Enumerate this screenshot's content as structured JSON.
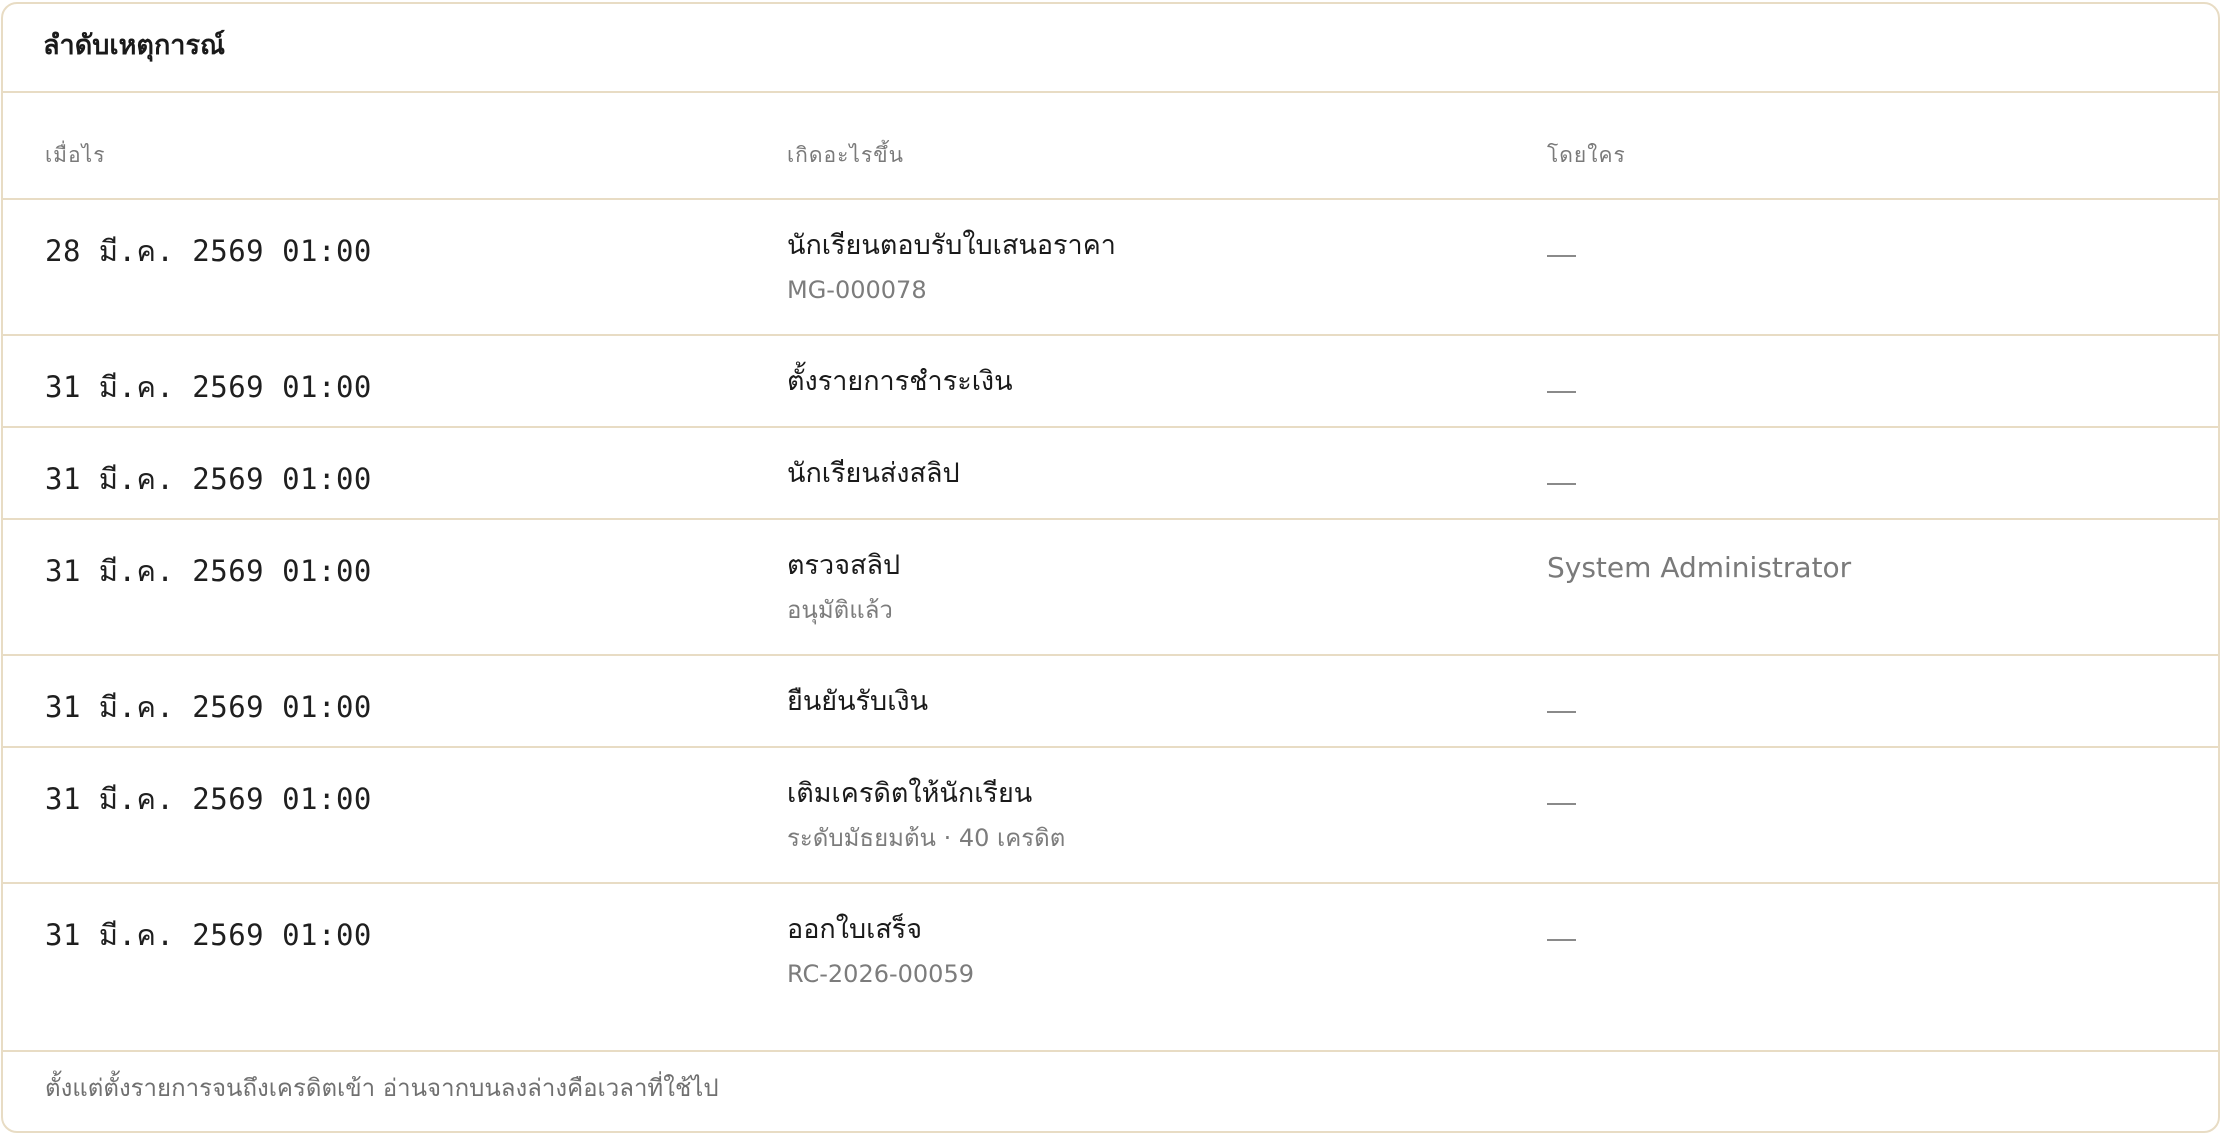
{
  "panel": {
    "title": "ลำดับเหตุการณ์",
    "footer_note": "ตั้งแต่ตั้งรายการจนถึงเครดิตเข้า อ่านจากบนลงล่างคือเวลาที่ใช้ไป"
  },
  "table": {
    "headers": {
      "when": "เมื่อไร",
      "what": "เกิดอะไรขึ้น",
      "who": "โดยใคร"
    },
    "rows": [
      {
        "when": "28 มี.ค. 2569 01:00",
        "what": "นักเรียนตอบรับใบเสนอราคา",
        "detail": "MG-000078",
        "who": "—"
      },
      {
        "when": "31 มี.ค. 2569 01:00",
        "what": "ตั้งรายการชำระเงิน",
        "detail": "",
        "who": "—"
      },
      {
        "when": "31 มี.ค. 2569 01:00",
        "what": "นักเรียนส่งสลิป",
        "detail": "",
        "who": "—"
      },
      {
        "when": "31 มี.ค. 2569 01:00",
        "what": "ตรวจสลิป",
        "detail": "อนุมัติแล้ว",
        "who": "System Administrator"
      },
      {
        "when": "31 มี.ค. 2569 01:00",
        "what": "ยืนยันรับเงิน",
        "detail": "",
        "who": "—"
      },
      {
        "when": "31 มี.ค. 2569 01:00",
        "what": "เติมเครดิตให้นักเรียน",
        "detail": "ระดับมัธยมต้น · 40 เครดิต",
        "who": "—"
      },
      {
        "when": "31 มี.ค. 2569 01:00",
        "what": "ออกใบเสร็จ",
        "detail": "RC-2026-00059",
        "who": "—"
      }
    ]
  },
  "colors": {
    "border": "#e8dcc4",
    "muted_text": "#7a7a7a",
    "primary_text": "#1a1a1a"
  }
}
